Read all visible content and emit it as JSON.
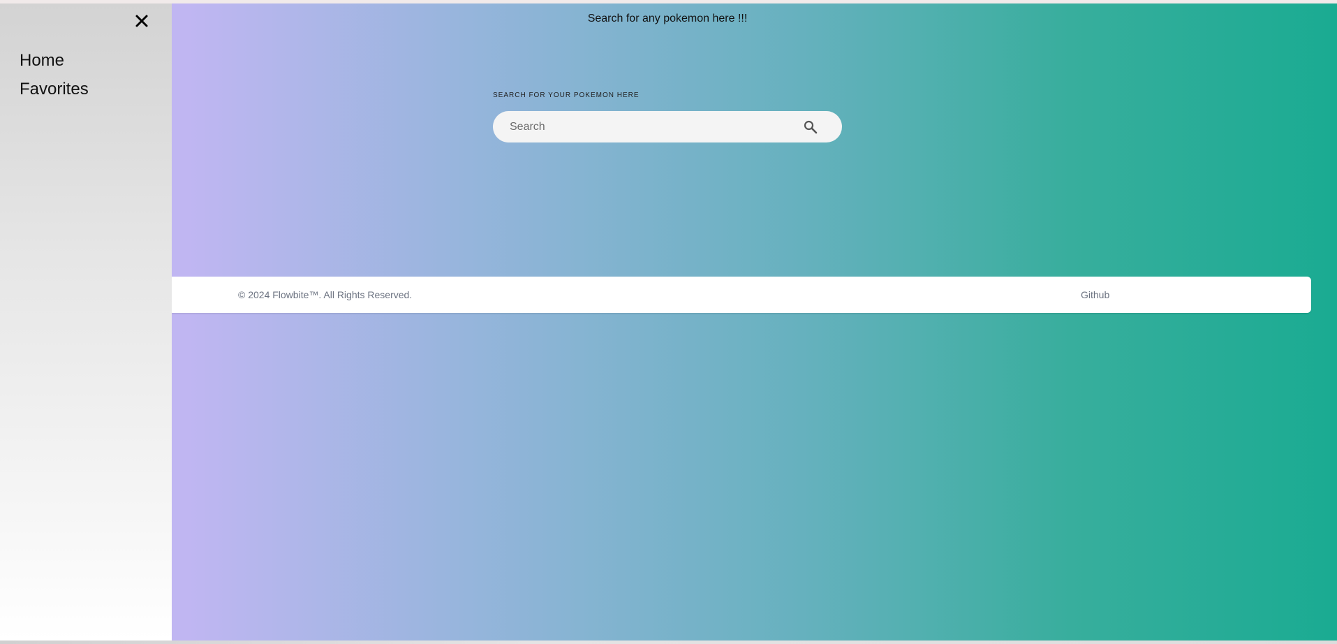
{
  "sidebar": {
    "close_icon": "close-icon",
    "items": [
      {
        "label": "Home"
      },
      {
        "label": "Favorites"
      }
    ]
  },
  "main": {
    "headline": "Search for any pokemon here !!!",
    "search": {
      "label": "SEARCH FOR YOUR POKEMON HERE",
      "placeholder": "Search",
      "icon": "search-icon"
    }
  },
  "footer": {
    "copyright": "© 2024 Flowbite™. All Rights Reserved.",
    "link": "Github"
  },
  "colors": {
    "gradient_start": "#c0b6f2",
    "gradient_end": "#1aab92",
    "sidebar_top": "#d3d3d3",
    "sidebar_bottom": "#ffffff"
  }
}
